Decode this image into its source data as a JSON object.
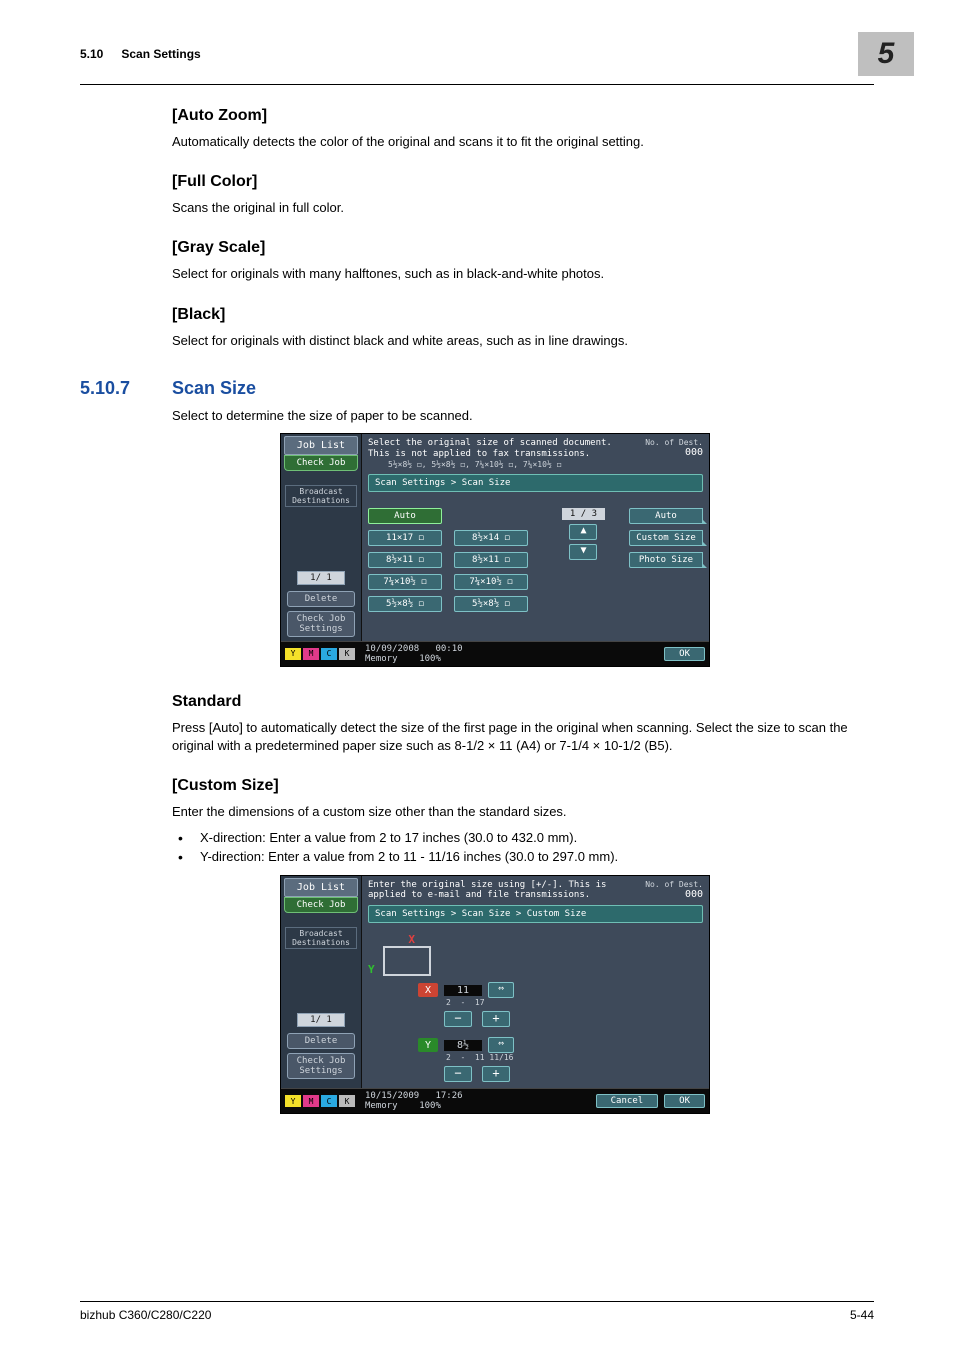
{
  "header": {
    "section_no": "5.10",
    "section_title": "Scan Settings",
    "chapter": "5"
  },
  "auto_zoom": {
    "title": "[Auto Zoom]",
    "text": "Automatically detects the color of the original and scans it to fit the original setting."
  },
  "full_color": {
    "title": "[Full Color]",
    "text": "Scans the original in full color."
  },
  "gray_scale": {
    "title": "[Gray Scale]",
    "text": "Select for originals with many halftones, such as in black-and-white photos."
  },
  "black": {
    "title": "[Black]",
    "text": "Select for originals with distinct black and white areas, such as in line drawings."
  },
  "scan_size": {
    "number": "5.10.7",
    "title": "Scan Size",
    "text": "Select to determine the size of paper to be scanned."
  },
  "standard": {
    "title": "Standard",
    "text": "Press [Auto] to automatically detect the size of the first page in the original when scanning. Select the size to scan the original with a predetermined paper size such as 8-1/2 × 11 (A4) or 7-1/4 × 10-1/2 (B5)."
  },
  "custom_size": {
    "title": "[Custom Size]",
    "text": "Enter the dimensions of a custom size other than the standard sizes.",
    "bullets": [
      "X-direction: Enter a value from 2 to 17 inches (30.0 to 432.0 mm).",
      "Y-direction: Enter a value from 2 to 11 - 11/16 inches (30.0 to 297.0 mm)."
    ]
  },
  "panel_common": {
    "job_list": "Job List",
    "check_job": "Check Job",
    "broadcast": "Broadcast\nDestinations",
    "page": "1/   1",
    "delete": "Delete",
    "check_settings": "Check Job\nSettings",
    "dest_label": "No. of\nDest.",
    "dest_count": "000",
    "memory_label": "Memory",
    "memory_pct": "100%",
    "ok": "OK",
    "cancel": "Cancel"
  },
  "panel1": {
    "msg1": "Select the original size of scanned document.",
    "msg2": "This is not applied to fax transmissions.",
    "sub_sizes": "5½×8½ ◻, 5½×8½ ◻, 7¼×10½ ◻, 7¼×10½ ◻",
    "breadcrumb": "Scan Settings > Scan Size",
    "left_col": [
      "Auto",
      "11×17 ◻",
      "8½×11 ◻",
      "7¼×10½ ◻",
      "5½×8½ ◻"
    ],
    "mid_col": [
      "8½×14 ◻",
      "8½×11 ◻",
      "7¼×10½ ◻",
      "5½×8½ ◻"
    ],
    "pager": "1 / 3",
    "right_col": [
      "Auto",
      "Custom Size",
      "Photo Size"
    ],
    "date": "10/09/2008",
    "time": "00:10"
  },
  "panel2": {
    "msg1": "Enter the original size using [+/-]. This is",
    "msg2": "applied to e-mail and file transmissions.",
    "breadcrumb": "Scan Settings > Scan Size > Custom Size",
    "x_val": "11",
    "x_range_lo": "2",
    "x_range_hi": "17",
    "y_val": "8½",
    "y_range_lo": "2",
    "y_range_hi": "11 11/16",
    "date": "10/15/2009",
    "time": "17:26"
  },
  "footer": {
    "left": "bizhub C360/C280/C220",
    "right": "5-44"
  }
}
